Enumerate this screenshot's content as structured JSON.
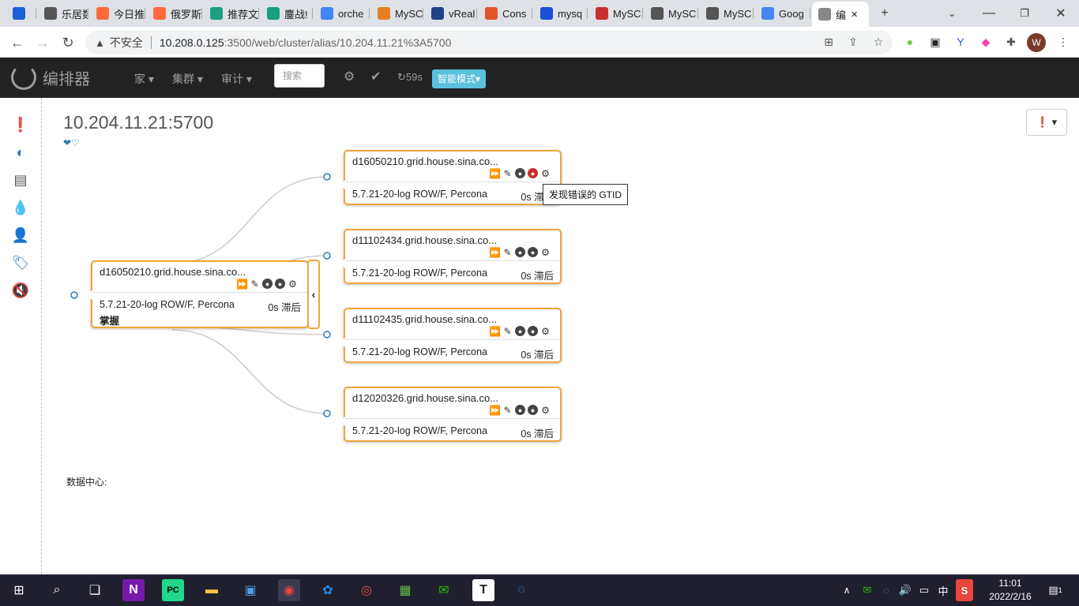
{
  "browser": {
    "tabs": [
      {
        "label": "",
        "icon": "y-logo-icon",
        "color": "#1a5fd6"
      },
      {
        "label": "乐居数",
        "icon": "globe-icon",
        "color": "#555555"
      },
      {
        "label": "今日推",
        "icon": "thumb-icon",
        "color": "#ff6a3d"
      },
      {
        "label": "俄罗斯",
        "icon": "thumb-icon",
        "color": "#ff6a3d"
      },
      {
        "label": "推荐文",
        "icon": "z-logo-icon",
        "color": "#1aa080"
      },
      {
        "label": "鏖战!",
        "icon": "z-logo-icon",
        "color": "#1aa080"
      },
      {
        "label": "orche",
        "icon": "google-icon",
        "color": "#4285f4"
      },
      {
        "label": "MySC",
        "icon": "mysql-icon",
        "color": "#e67e22"
      },
      {
        "label": "vReal",
        "icon": "vmware-icon",
        "color": "#1d428a"
      },
      {
        "label": "Cons",
        "icon": "c-logo-icon",
        "color": "#e2522a"
      },
      {
        "label": "mysq",
        "icon": "blue-logo-icon",
        "color": "#1a4fd6"
      },
      {
        "label": "MySC",
        "icon": "51-logo-icon",
        "color": "#c9302c"
      },
      {
        "label": "MySC",
        "icon": "dolphin-icon",
        "color": "#555555"
      },
      {
        "label": "MySC",
        "icon": "dolphin-icon",
        "color": "#555555"
      },
      {
        "label": "Goog",
        "icon": "translate-icon",
        "color": "#4285f4"
      },
      {
        "label": "编",
        "icon": "loading-icon",
        "color": "#888888",
        "active": true
      }
    ],
    "new_tab": "+",
    "security_label": "不安全",
    "url_host": "10.208.0.125",
    "url_path": ":3500/web/cluster/alias/10.204.11.21%3A5700",
    "profile_initial": "W"
  },
  "app": {
    "brand": "编排器",
    "menus": [
      "家",
      "集群",
      "审计"
    ],
    "search_placeholder": "搜索",
    "refresh_label": "59s",
    "smart_mode": "智能模式"
  },
  "page": {
    "cluster_title": "10.204.11.21:5700",
    "hearts": "❤♡",
    "datacenter_label": "数据中心:",
    "tooltip": "发现错误的 GTID"
  },
  "nodes": {
    "master": {
      "host": "d16050210.grid.house.sina.co...",
      "version": "5.7.21-20-log ROW/F, Percona",
      "lag": "0s 滞后",
      "role": "掌握"
    },
    "replicas": [
      {
        "host": "d16050210.grid.house.sina.co...",
        "version": "5.7.21-20-log ROW/F, Percona",
        "lag": "0s 滞后",
        "gtid_error": true
      },
      {
        "host": "d11102434.grid.house.sina.co...",
        "version": "5.7.21-20-log ROW/F, Percona",
        "lag": "0s 滞后",
        "gtid_error": false
      },
      {
        "host": "d11102435.grid.house.sina.co...",
        "version": "5.7.21-20-log ROW/F, Percona",
        "lag": "0s 滞后",
        "gtid_error": false
      },
      {
        "host": "d12020326.grid.house.sina.co...",
        "version": "5.7.21-20-log ROW/F, Percona",
        "lag": "0s 滞后",
        "gtid_error": false
      }
    ]
  },
  "taskbar": {
    "ime": "中",
    "time": "11:01",
    "date": "2022/2/16",
    "notifications": "1"
  },
  "colors": {
    "accent": "#f0a53c",
    "nav_bg": "#222222",
    "link": "#337ab7",
    "error": "#c9302c",
    "info": "#5bc0de"
  }
}
